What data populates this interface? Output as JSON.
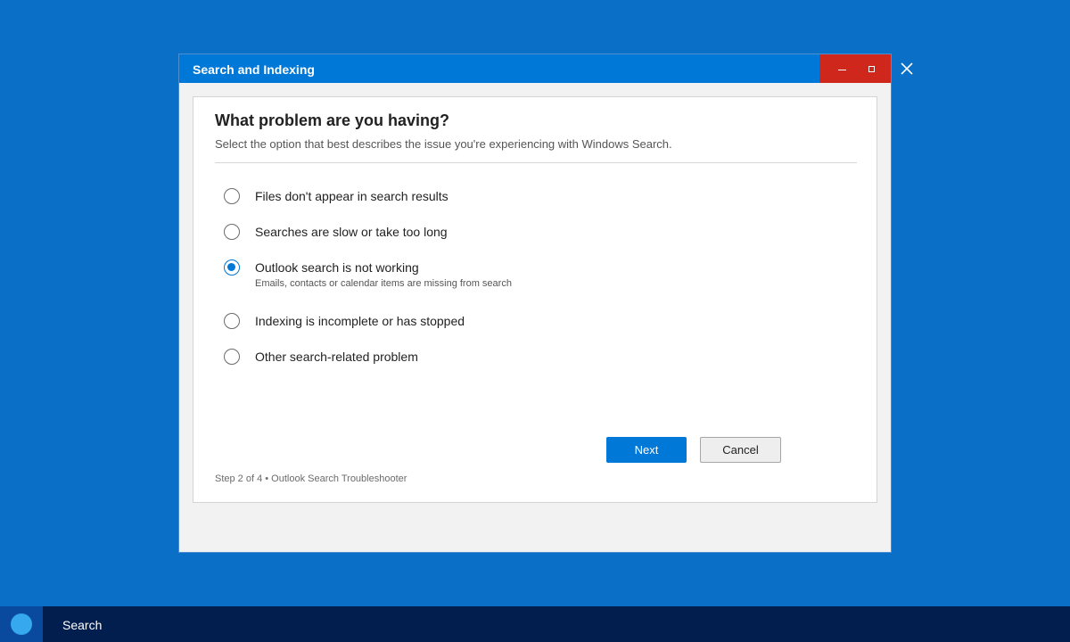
{
  "window": {
    "title": "Search and Indexing"
  },
  "dialog": {
    "heading": "What problem are you having?",
    "subheading": "Select the option that best describes the issue you're experiencing with Windows Search.",
    "options": [
      {
        "label": "Files don't appear in search results",
        "selected": false
      },
      {
        "label": "Searches are slow or take too long",
        "selected": false
      },
      {
        "label": "Outlook search is not working",
        "description": "Emails, contacts or calendar items are missing from search",
        "selected": true
      },
      {
        "label": "Indexing is incomplete or has stopped",
        "selected": false
      },
      {
        "label": "Other search-related problem",
        "selected": false
      }
    ],
    "next_label": "Next",
    "cancel_label": "Cancel",
    "footer": "Step 2 of 4 • Outlook Search Troubleshooter"
  },
  "taskbar": {
    "search_label": "Search"
  },
  "colors": {
    "desktop": "#0a70c7",
    "titlebar": "#0078d7",
    "window_controls": "#d0271c",
    "accent": "#0078d7",
    "taskbar": "#011e4f"
  },
  "icons": {
    "minimize": "minimize-icon",
    "maximize": "maximize-icon",
    "close": "close-icon",
    "start": "start-icon"
  }
}
